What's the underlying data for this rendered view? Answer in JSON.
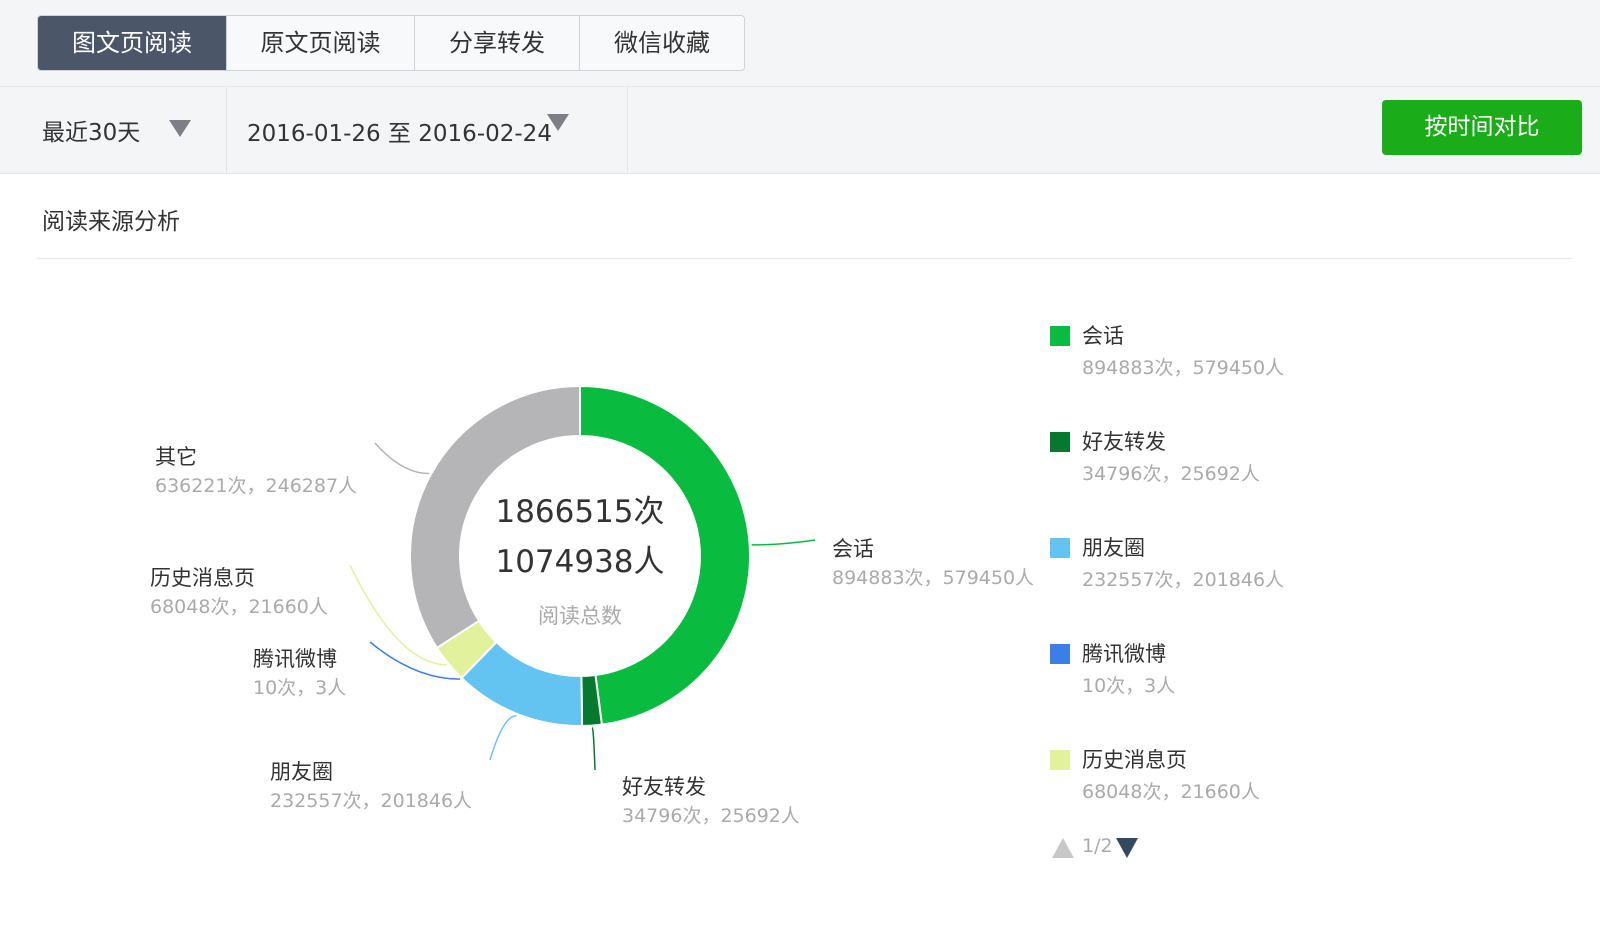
{
  "tabs": [
    {
      "label": "图文页阅读",
      "active": true
    },
    {
      "label": "原文页阅读",
      "active": false
    },
    {
      "label": "分享转发",
      "active": false
    },
    {
      "label": "微信收藏",
      "active": false
    }
  ],
  "filters": {
    "range_label": "最近30天",
    "date_range": "2016-01-26 至 2016-02-24",
    "compare_button": "按时间对比"
  },
  "section": {
    "title": "阅读来源分析"
  },
  "colors": {
    "accent": "#1aad19",
    "active_tab": "#4c5669",
    "session": "#09bb3f",
    "friend_forward": "#06792f",
    "moments": "#63c3f1",
    "tencent_weibo": "#3a7ee6",
    "history": "#e2f29c",
    "other": "#b5b5b7"
  },
  "chart_data": {
    "type": "pie",
    "variant": "donut",
    "center": {
      "total_reads": "1866515次",
      "total_users": "1074938人",
      "label": "阅读总数"
    },
    "slices": [
      {
        "name": "会话",
        "reads": 894883,
        "users": 579450,
        "stats": "894883次，579450人",
        "color": "#09bb3f"
      },
      {
        "name": "好友转发",
        "reads": 34796,
        "users": 25692,
        "stats": "34796次，25692人",
        "color": "#06792f"
      },
      {
        "name": "朋友圈",
        "reads": 232557,
        "users": 201846,
        "stats": "232557次，201846人",
        "color": "#63c3f1"
      },
      {
        "name": "腾讯微博",
        "reads": 10,
        "users": 3,
        "stats": "10次，3人",
        "color": "#3a7ee6"
      },
      {
        "name": "历史消息页",
        "reads": 68048,
        "users": 21660,
        "stats": "68048次，21660人",
        "color": "#e2f29c"
      },
      {
        "name": "其它",
        "reads": 636221,
        "users": 246287,
        "stats": "636221次，246287人",
        "color": "#b5b5b7"
      }
    ],
    "legend": {
      "position": "right",
      "items": [
        {
          "name": "会话",
          "stats": "894883次，579450人",
          "color": "#09bb3f"
        },
        {
          "name": "好友转发",
          "stats": "34796次，25692人",
          "color": "#06792f"
        },
        {
          "name": "朋友圈",
          "stats": "232557次，201846人",
          "color": "#63c3f1"
        },
        {
          "name": "腾讯微博",
          "stats": "10次，3人",
          "color": "#3a7ee6"
        },
        {
          "name": "历史消息页",
          "stats": "68048次，21660人",
          "color": "#e2f29c"
        }
      ],
      "page": "1/2"
    }
  }
}
